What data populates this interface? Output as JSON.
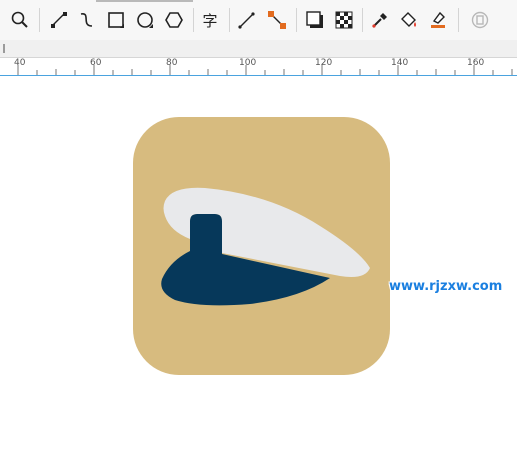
{
  "toolbar": {
    "tools": [
      {
        "icon": "zoom-icon",
        "label": "Zoom"
      },
      {
        "icon": "freehand-icon",
        "label": "Freehand"
      },
      {
        "icon": "bezier-icon",
        "label": "Bezier"
      },
      {
        "icon": "rectangle-icon",
        "label": "Rectangle"
      },
      {
        "icon": "ellipse-icon",
        "label": "Ellipse"
      },
      {
        "icon": "polygon-icon",
        "label": "Polygon"
      },
      {
        "icon": "text-icon",
        "label": "字"
      },
      {
        "icon": "connector-icon",
        "label": "Connector"
      },
      {
        "icon": "dimension-icon",
        "label": "Dimension"
      },
      {
        "icon": "drop-shadow-icon",
        "label": "Drop shadow"
      },
      {
        "icon": "transparency-icon",
        "label": "Transparency"
      },
      {
        "icon": "eyedropper-icon",
        "label": "Eyedropper"
      },
      {
        "icon": "fill-icon",
        "label": "Fill"
      },
      {
        "icon": "smart-fill-icon",
        "label": "Smart fill"
      },
      {
        "icon": "copy-properties-icon",
        "label": "Copy properties"
      }
    ]
  },
  "ruler": {
    "labels": [
      "40",
      "60",
      "80",
      "100",
      "120",
      "140",
      "160"
    ]
  },
  "artwork": {
    "background_color": "#d7bb7f",
    "cap_top_color": "#e8e9eb",
    "cap_band_color": "#06385a"
  },
  "watermark": {
    "text": "www.rjzxw.com",
    "color": "#1a7fe0"
  }
}
